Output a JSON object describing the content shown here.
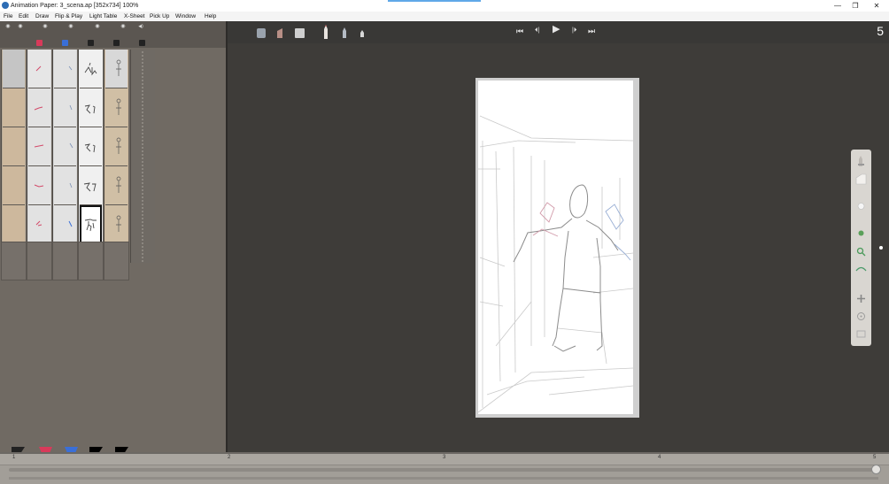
{
  "window": {
    "title": "Animation Paper: 3_scena.ap [352x734] 100%",
    "minimize": "—",
    "maximize": "❐",
    "close": "✕"
  },
  "menu": [
    "File",
    "Edit",
    "Draw",
    "Flip & Play",
    "Light Table",
    "X-Sheet",
    "Pick Up",
    "Window",
    "Help"
  ],
  "layers": {
    "header_eye": "◉",
    "sound": "◀)",
    "columns": 5
  },
  "transport": {
    "first": "⏮",
    "prev": "⏴|",
    "play": "▶",
    "next": "|⏵",
    "last": "⏭"
  },
  "frame_number": "5",
  "timeline": {
    "marks": [
      "1",
      "2",
      "3",
      "4",
      "5"
    ]
  },
  "colors": {
    "accent_blue": "#5fa8e8",
    "swatch_red": "#d83a5a",
    "swatch_blue": "#3a6fd8",
    "swatch_black": "#000000"
  }
}
